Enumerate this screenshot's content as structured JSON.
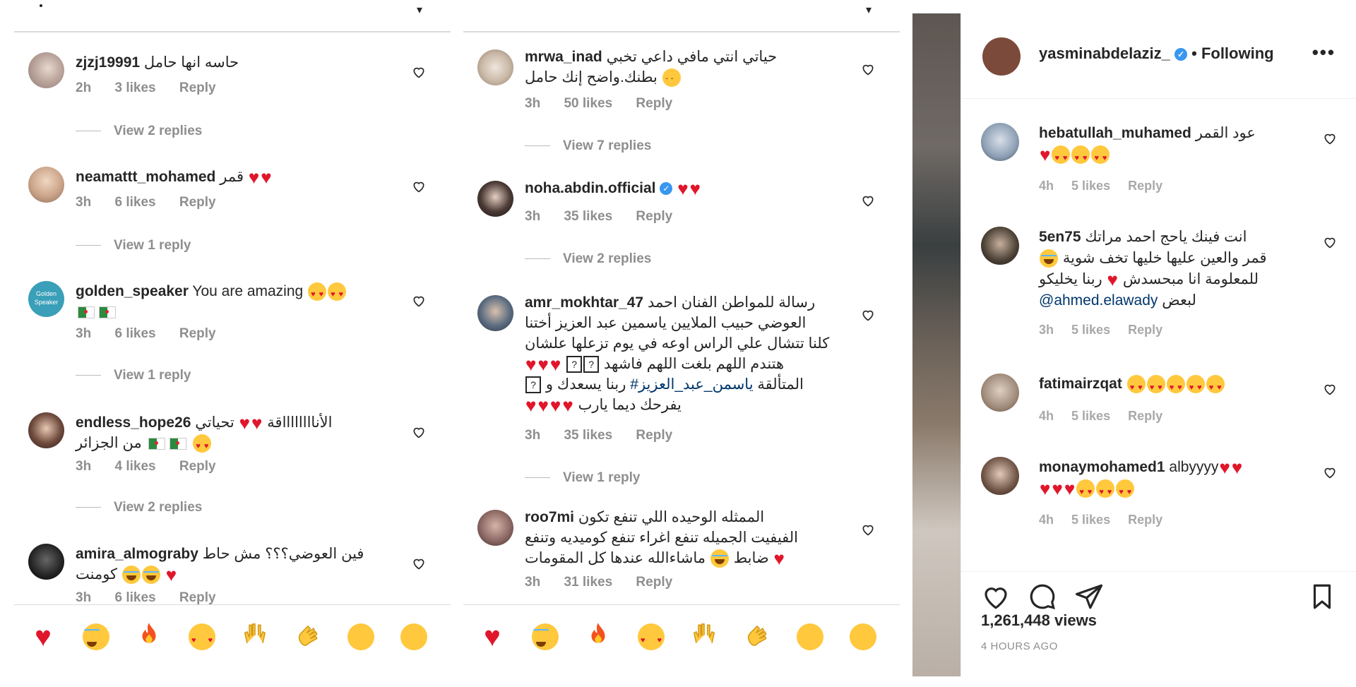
{
  "panel1": {
    "comments": [
      {
        "user": "zjzj19991",
        "text": "حاسه انها حامل",
        "time": "2h",
        "likes": "3 likes",
        "reply": "Reply",
        "replies": "View 2 replies"
      },
      {
        "user": "neamattt_mohamed",
        "text": "قمر",
        "time": "3h",
        "likes": "6 likes",
        "reply": "Reply",
        "replies": "View 1 reply"
      },
      {
        "user": "golden_speaker",
        "text": "You are amazing",
        "time": "3h",
        "likes": "6 likes",
        "reply": "Reply",
        "replies": "View 1 reply"
      },
      {
        "user": "endless_hope26",
        "text": "تحياتي",
        "text2": "الأنااااااااقة",
        "text3": "من الجزائر",
        "time": "3h",
        "likes": "4 likes",
        "reply": "Reply",
        "replies": "View 2 replies"
      },
      {
        "user": "amira_almograby",
        "text": "فين العوضي؟؟؟ مش حاط",
        "text2": "كومنت",
        "time": "3h",
        "likes": "6 likes",
        "reply": "Reply"
      }
    ]
  },
  "panel2": {
    "comments": [
      {
        "user": "mrwa_inad",
        "text": "حياتي انتي مافي داعي تخبي",
        "text2": "بطنك.واضح إنك حامل",
        "time": "3h",
        "likes": "50 likes",
        "reply": "Reply",
        "replies": "View 7 replies"
      },
      {
        "user": "noha.abdin.official",
        "time": "3h",
        "likes": "35 likes",
        "reply": "Reply",
        "replies": "View 2 replies"
      },
      {
        "user": "amr_mokhtar_47",
        "l1": "رسالة للمواطن الفنان احمد",
        "l2": "العوضي حبيب الملايين ياسمين عبد العزيز أختنا",
        "l3": "كلنا تتشال علي الراس اوعه في يوم تزعلها علشان",
        "l4": "هتندم اللهم بلغت اللهم فاشهد",
        "l5a": "المتألقة",
        "l5tag": "#ياسمن_عبد_العزيز",
        "l5b": "ربنا يسعدك و",
        "l6": "يفرحك ديما يارب",
        "qmark": "?",
        "time": "3h",
        "likes": "35 likes",
        "reply": "Reply",
        "replies": "View 1 reply"
      },
      {
        "user": "roo7mi",
        "l1": "الممثله الوحيده اللي تنفع تكون",
        "l2": "الفيفيت الجميله تنفع اغراء تنفع كوميديه وتنفع",
        "l3a": "ضابط",
        "l3b": "ماشاءالله عندها كل المقومات",
        "time": "3h",
        "likes": "31 likes",
        "reply": "Reply"
      }
    ]
  },
  "emoji_bar": [
    "red-heart",
    "tears-of-joy",
    "fire",
    "heart-eyes",
    "raised-hands",
    "clapping-hands",
    "crying-face",
    "surprised-face"
  ],
  "right_panel": {
    "username": "yasminabdelaziz_",
    "following": "• Following",
    "more": "•••",
    "comments": [
      {
        "user": "hebatullah_muhamed",
        "text": "عود القمر",
        "time": "4h",
        "likes": "5 likes",
        "reply": "Reply"
      },
      {
        "user": "5en75",
        "l1": "انت فينك ياحج احمد مراتك",
        "l2": "قمر والعين عليها خليها تخف شوية",
        "l3a": "للمعلومة انا مبحسدش",
        "l3b": "ربنا يخليكو",
        "l4a": "لبعض",
        "mention": "@ahmed.elawady",
        "time": "3h",
        "likes": "5 likes",
        "reply": "Reply"
      },
      {
        "user": "fatimairzqat",
        "time": "4h",
        "likes": "5 likes",
        "reply": "Reply"
      },
      {
        "user": "monaymohamed1",
        "text": "albyyyy",
        "time": "4h",
        "likes": "5 likes",
        "reply": "Reply"
      }
    ],
    "views": "1,261,448 views",
    "ago": "4 HOURS AGO"
  },
  "colors": {
    "heart": "#e0162b",
    "meta": "#8e8e8e",
    "mention": "#00376b",
    "verified": "#3897f0"
  }
}
